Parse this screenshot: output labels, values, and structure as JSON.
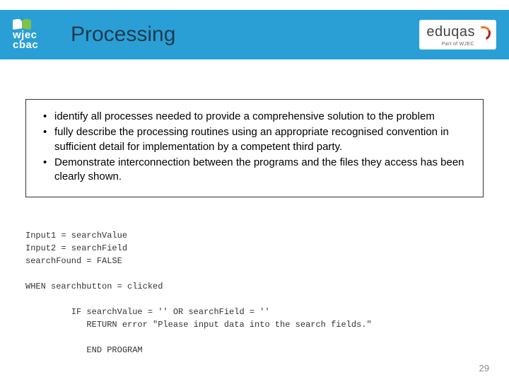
{
  "header": {
    "title": "Processing",
    "logo_left": {
      "line1": "wjec",
      "line2": "cbac"
    },
    "logo_right": {
      "brand": "eduqas",
      "subtitle": "Part of WJEC"
    }
  },
  "bullets": [
    "identify all processes needed to provide a comprehensive solution to the problem",
    "fully describe the processing routines using an appropriate recognised convention in sufficient detail for implementation by a competent third party.",
    "Demonstrate interconnection between the programs and the files they access has been clearly shown."
  ],
  "code": "Input1 = searchValue\nInput2 = searchField\nsearchFound = FALSE\n\nWHEN searchbutton = clicked\n\n         IF searchValue = '' OR searchField = ''\n            RETURN error \"Please input data into the search fields.\"\n\n            END PROGRAM",
  "page_number": "29"
}
